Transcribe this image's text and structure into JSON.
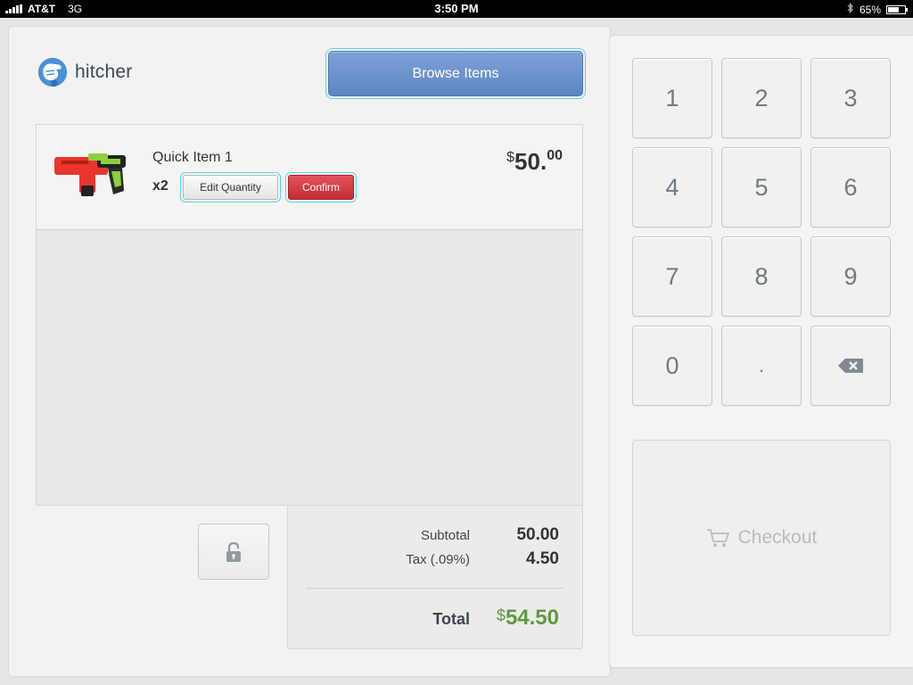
{
  "status_bar": {
    "carrier": "AT&T",
    "network": "3G",
    "time": "3:50 PM",
    "battery_percent": "65%",
    "battery_level": 0.65
  },
  "header": {
    "app_name": "hitcher",
    "browse_label": "Browse Items"
  },
  "cart": {
    "items": [
      {
        "name": "Quick Item 1",
        "quantity": "x2",
        "edit_label": "Edit Quantity",
        "confirm_label": "Confirm",
        "price_currency": "$",
        "price_whole": "50.",
        "price_cents": "00"
      }
    ]
  },
  "totals": {
    "subtotal_label": "Subtotal",
    "subtotal_value": "50.00",
    "tax_label": "Tax (.09%)",
    "tax_value": "4.50",
    "total_label": "Total",
    "total_currency": "$",
    "total_value": "54.50"
  },
  "keypad": {
    "keys": [
      "1",
      "2",
      "3",
      "4",
      "5",
      "6",
      "7",
      "8",
      "9",
      "0",
      "."
    ],
    "checkout_label": "Checkout"
  },
  "colors": {
    "brand_blue": "#4a90d9",
    "browse_button": "#6b91c9",
    "confirm_red": "#d23b43",
    "total_green": "#5e9a3e"
  }
}
